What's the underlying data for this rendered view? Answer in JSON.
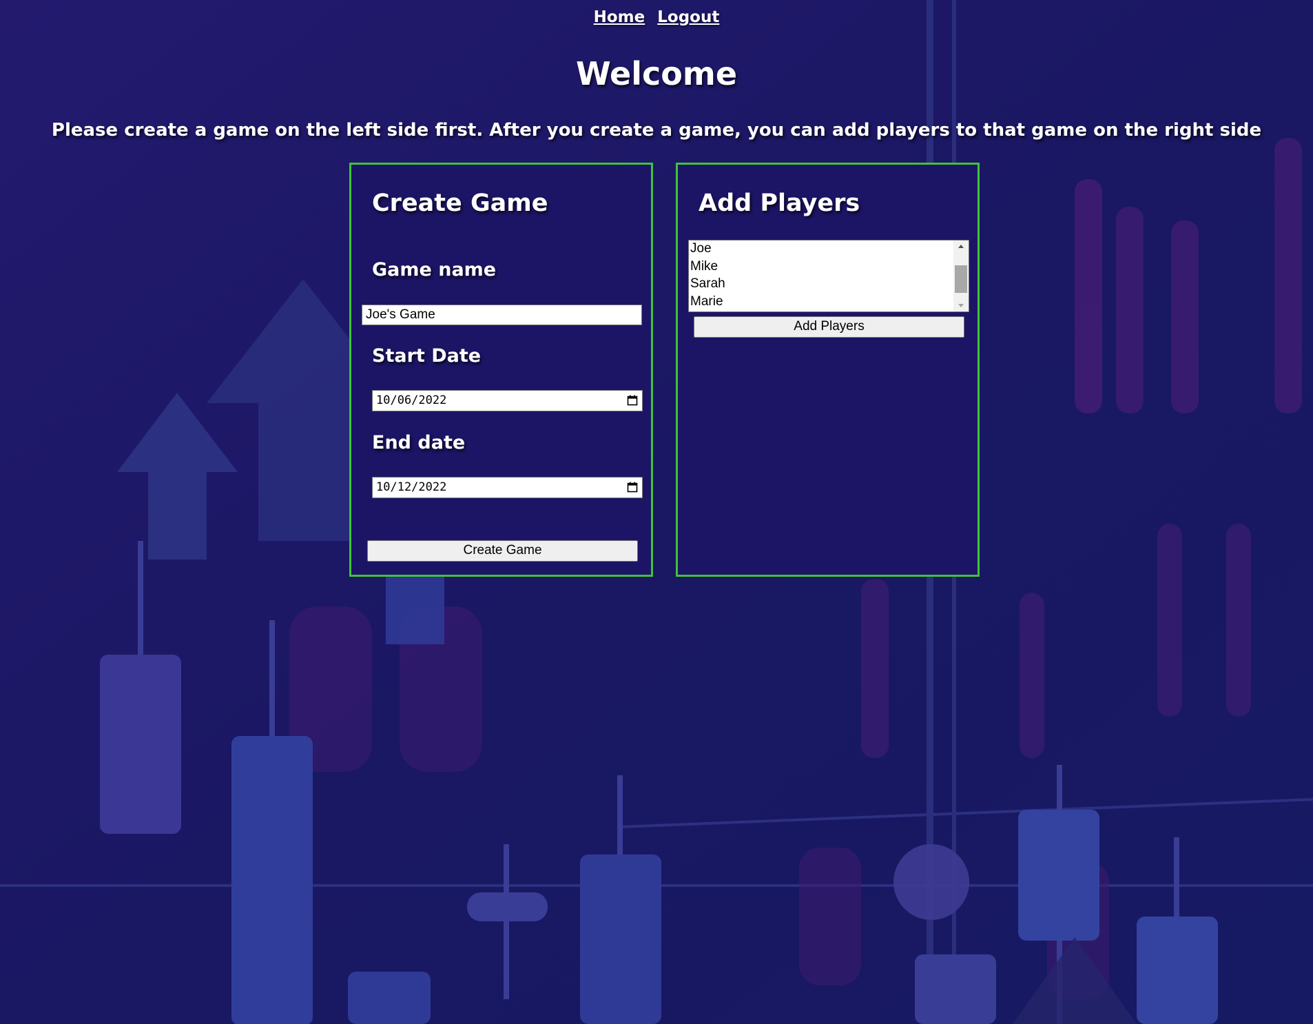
{
  "nav": {
    "home": "Home",
    "logout": "Logout"
  },
  "page": {
    "title": "Welcome",
    "instructions": "Please create a game on the left side first. After you create a game, you can add players to that game on the right side"
  },
  "create_game": {
    "heading": "Create Game",
    "game_name_label": "Game name",
    "game_name_value": "Joe's Game",
    "start_date_label": "Start Date",
    "start_date_value": "10/06/2022",
    "end_date_label": "End date",
    "end_date_value": "10/12/2022",
    "submit_label": "Create Game"
  },
  "add_players": {
    "heading": "Add Players",
    "players": [
      "Joe",
      "Mike",
      "Sarah",
      "Marie"
    ],
    "submit_label": "Add Players"
  },
  "colors": {
    "panel_border": "#3ec43a",
    "panel_background": "#1c1566",
    "page_background": "#191660"
  },
  "icons": {
    "date_picker": "calendar-icon",
    "scroll_up": "arrow-up-icon",
    "scroll_down": "arrow-down-icon"
  }
}
